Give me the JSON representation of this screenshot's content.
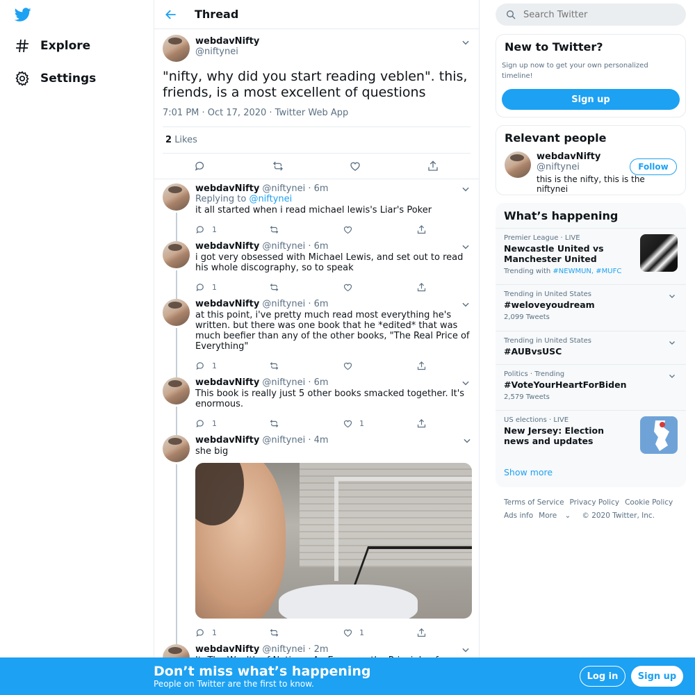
{
  "nav": {
    "logo": "twitter-bird-icon",
    "items": [
      {
        "label": "Explore",
        "icon": "hashtag-icon"
      },
      {
        "label": "Settings",
        "icon": "gear-icon"
      }
    ]
  },
  "header": {
    "title": "Thread"
  },
  "main_tweet": {
    "name": "webdavNifty",
    "handle": "@niftynei",
    "text": "\"nifty, why did you start reading veblen\". this, friends, is a most excellent of questions",
    "meta": "7:01 PM · Oct 17, 2020 · Twitter Web App",
    "likes_count": "2",
    "likes_label": "Likes"
  },
  "replies": [
    {
      "name": "webdavNifty",
      "handle": "@niftynei · 6m",
      "replying_prefix": "Replying to",
      "replying_to": "@niftynei",
      "text": "it all started when i read michael lewis's Liar's Poker",
      "reply_count": "1",
      "like_count": ""
    },
    {
      "name": "webdavNifty",
      "handle": "@niftynei · 6m",
      "text": "i got very obsessed with Michael Lewis, and set out to read his whole discography, so to speak",
      "reply_count": "1",
      "like_count": ""
    },
    {
      "name": "webdavNifty",
      "handle": "@niftynei · 6m",
      "text": "at this point, i've pretty much read most everything he's written. but there was one book that he *edited* that was much beefier than any of the other books, \"The Real Price of Everything\"",
      "reply_count": "1",
      "like_count": ""
    },
    {
      "name": "webdavNifty",
      "handle": "@niftynei · 6m",
      "text": "This book is really just 5 other books smacked together. It's enormous.",
      "reply_count": "1",
      "like_count": "1"
    },
    {
      "name": "webdavNifty",
      "handle": "@niftynei · 4m",
      "text": "she big",
      "reply_count": "1",
      "like_count": "1"
    },
    {
      "name": "webdavNifty",
      "handle": "@niftynei · 2m",
      "text": "It: The Wealth of Nations, An Essay on the Principle of Population"
    }
  ],
  "search": {
    "placeholder": "Search Twitter"
  },
  "new_card": {
    "title": "New to Twitter?",
    "subtitle": "Sign up now to get your own personalized timeline!",
    "button": "Sign up"
  },
  "people_card": {
    "title": "Relevant people",
    "name": "webdavNifty",
    "handle": "@niftynei",
    "bio": "this is the nifty, this is the niftynei",
    "follow": "Follow"
  },
  "happening": {
    "title": "What’s happening",
    "trends": [
      {
        "meta": "Premier League · LIVE",
        "title": "Newcastle United vs Manchester United",
        "sub_prefix": "Trending with",
        "sub_links": "#NEWMUN, #MUFC"
      },
      {
        "meta": "Trending in United States",
        "title": "#weloveyoudream",
        "sub": "2,099 Tweets"
      },
      {
        "meta": "Trending in United States",
        "title": "#AUBvsUSC"
      },
      {
        "meta": "Politics · Trending",
        "title": "#VoteYourHeartForBiden",
        "sub": "2,579 Tweets"
      },
      {
        "meta": "US elections · LIVE",
        "title": "New Jersey: Election news and updates"
      }
    ],
    "show_more": "Show more"
  },
  "footer": {
    "links": [
      "Terms of Service",
      "Privacy Policy",
      "Cookie Policy",
      "Ads info",
      "More",
      "© 2020 Twitter, Inc."
    ]
  },
  "bottom_bar": {
    "title": "Don’t miss what’s happening",
    "subtitle": "People on Twitter are the first to know.",
    "login": "Log in",
    "signup": "Sign up"
  },
  "colors": {
    "accent": "#1da1f2",
    "text": "#0f1419",
    "muted": "#5b7083",
    "border": "#e6ecf0"
  }
}
